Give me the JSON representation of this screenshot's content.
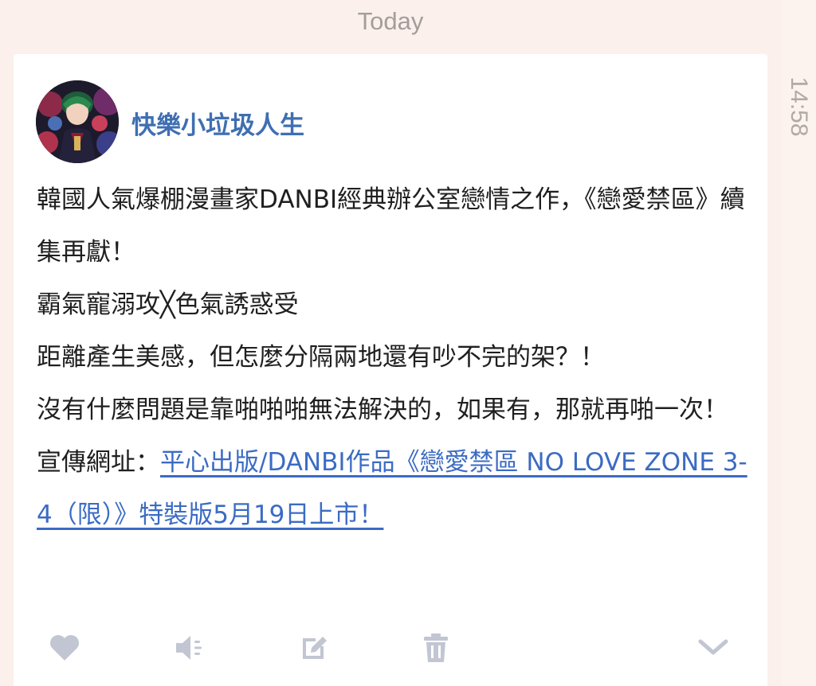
{
  "date_header": "Today",
  "timestamp": "14:58",
  "post": {
    "author": "快樂小垃圾人生",
    "lines": [
      "韓國人氣爆棚漫畫家DANBI經典辦公室戀情之作，《戀愛禁區》續集再獻！",
      "霸氣寵溺攻╳色氣誘惑受",
      "距離產生美感，但怎麼分隔兩地還有吵不完的架？！",
      "沒有什麼問題是靠啪啪啪無法解決的，如果有，那就再啪一次！"
    ],
    "link_prefix": "宣傳網址：",
    "link_text": "平心出版/DANBI作品《戀愛禁區 NO LOVE ZONE 3-4（限）》特裝版5月19日上市！"
  },
  "actions": [
    {
      "name": "heart-icon",
      "color": "#c2c6d2"
    },
    {
      "name": "speaker-icon",
      "color": "#c2c6d2"
    },
    {
      "name": "edit-icon",
      "color": "#c2c6d2"
    },
    {
      "name": "trash-icon",
      "color": "#c2c6d2"
    },
    {
      "name": "chevron-down-icon",
      "color": "#c2c6d2"
    }
  ],
  "colors": {
    "background": "#fbf0ec",
    "author": "#3f6fb2",
    "link": "#3b6bc4",
    "icon": "#c2c6d2"
  }
}
